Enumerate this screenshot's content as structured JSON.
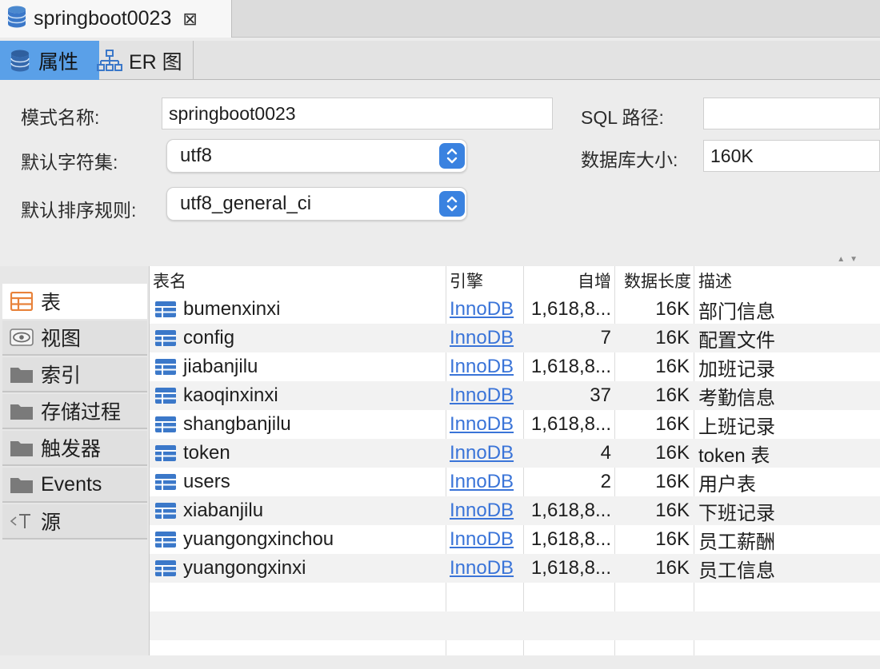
{
  "editor_tab": {
    "title": "springboot0023",
    "close_glyph": "⊠"
  },
  "subtabs": {
    "properties": "属性",
    "er": "ER 图"
  },
  "form": {
    "schema_name_label": "模式名称:",
    "schema_name_value": "springboot0023",
    "charset_label": "默认字符集:",
    "charset_value": "utf8",
    "collation_label": "默认排序规则:",
    "collation_value": "utf8_general_ci",
    "sql_path_label": "SQL 路径:",
    "sql_path_value": "",
    "db_size_label": "数据库大小:",
    "db_size_value": "160K"
  },
  "nav": {
    "items": [
      {
        "label": "表",
        "icon": "table-icon"
      },
      {
        "label": "视图",
        "icon": "eye-icon"
      },
      {
        "label": "索引",
        "icon": "folder-icon"
      },
      {
        "label": "存储过程",
        "icon": "folder-icon"
      },
      {
        "label": "触发器",
        "icon": "folder-icon"
      },
      {
        "label": "Events",
        "icon": "folder-icon"
      },
      {
        "label": "源",
        "icon": "source-icon"
      }
    ]
  },
  "table": {
    "headers": {
      "name": "表名",
      "engine": "引擎",
      "auto_increment": "自增",
      "data_length": "数据长度",
      "comment": "描述"
    },
    "rows": [
      {
        "name": "bumenxinxi",
        "engine": "InnoDB",
        "auto_increment": "1,618,8...",
        "data_length": "16K",
        "comment": "部门信息"
      },
      {
        "name": "config",
        "engine": "InnoDB",
        "auto_increment": "7",
        "data_length": "16K",
        "comment": "配置文件"
      },
      {
        "name": "jiabanjilu",
        "engine": "InnoDB",
        "auto_increment": "1,618,8...",
        "data_length": "16K",
        "comment": "加班记录"
      },
      {
        "name": "kaoqinxinxi",
        "engine": "InnoDB",
        "auto_increment": "37",
        "data_length": "16K",
        "comment": "考勤信息"
      },
      {
        "name": "shangbanjilu",
        "engine": "InnoDB",
        "auto_increment": "1,618,8...",
        "data_length": "16K",
        "comment": "上班记录"
      },
      {
        "name": "token",
        "engine": "InnoDB",
        "auto_increment": "4",
        "data_length": "16K",
        "comment": "token 表"
      },
      {
        "name": "users",
        "engine": "InnoDB",
        "auto_increment": "2",
        "data_length": "16K",
        "comment": "用户表"
      },
      {
        "name": "xiabanjilu",
        "engine": "InnoDB",
        "auto_increment": "1,618,8...",
        "data_length": "16K",
        "comment": "下班记录"
      },
      {
        "name": "yuangongxinchou",
        "engine": "InnoDB",
        "auto_increment": "1,618,8...",
        "data_length": "16K",
        "comment": "员工薪酬"
      },
      {
        "name": "yuangongxinxi",
        "engine": "InnoDB",
        "auto_increment": "1,618,8...",
        "data_length": "16K",
        "comment": "员工信息"
      }
    ]
  },
  "colors": {
    "accent": "#5aa0e8",
    "select_button": "#3a82e0",
    "link": "#3a74d8",
    "table_icon": "#3b78c9",
    "nav_active_icon": "#e8823a"
  }
}
